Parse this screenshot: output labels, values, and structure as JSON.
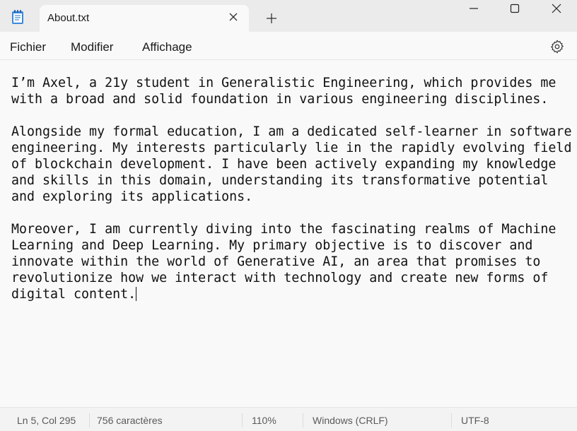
{
  "window": {
    "tab_title": "About.txt"
  },
  "menu": {
    "file": "Fichier",
    "edit": "Modifier",
    "view": "Affichage"
  },
  "editor": {
    "lines": [
      "I’m Axel, a 21y student in Generalistic Engineering, which provides me",
      "with a broad and solid foundation in various engineering disciplines.",
      "",
      "Alongside my formal education, I am a dedicated self-learner in software",
      "engineering. My interests particularly lie in the rapidly evolving field",
      "of blockchain development. I have been actively expanding my knowledge",
      "and skills in this domain, understanding its transformative potential",
      "and exploring its applications.",
      "",
      "Moreover, I am currently diving into the fascinating realms of Machine",
      "Learning and Deep Learning. My primary objective is to discover and",
      "innovate within the world of Generative AI, an area that promises to",
      "revolutionize how we interact with technology and create new forms of",
      "digital content."
    ]
  },
  "status": {
    "position": "Ln 5, Col 295",
    "char_count": "756 caractères",
    "zoom": "110%",
    "line_ending": "Windows (CRLF)",
    "encoding": "UTF-8"
  },
  "icons": {
    "app": "notepad-icon",
    "tab_close": "close-icon",
    "new_tab": "plus-icon",
    "minimize": "minimize-icon",
    "maximize": "maximize-icon",
    "close": "close-icon",
    "settings": "gear-icon"
  },
  "colors": {
    "titlebar": "#ebebeb",
    "background": "#f9f9f9",
    "statusbar": "#f3f3f3",
    "text": "#111111",
    "status_text": "#5a5a5a"
  }
}
